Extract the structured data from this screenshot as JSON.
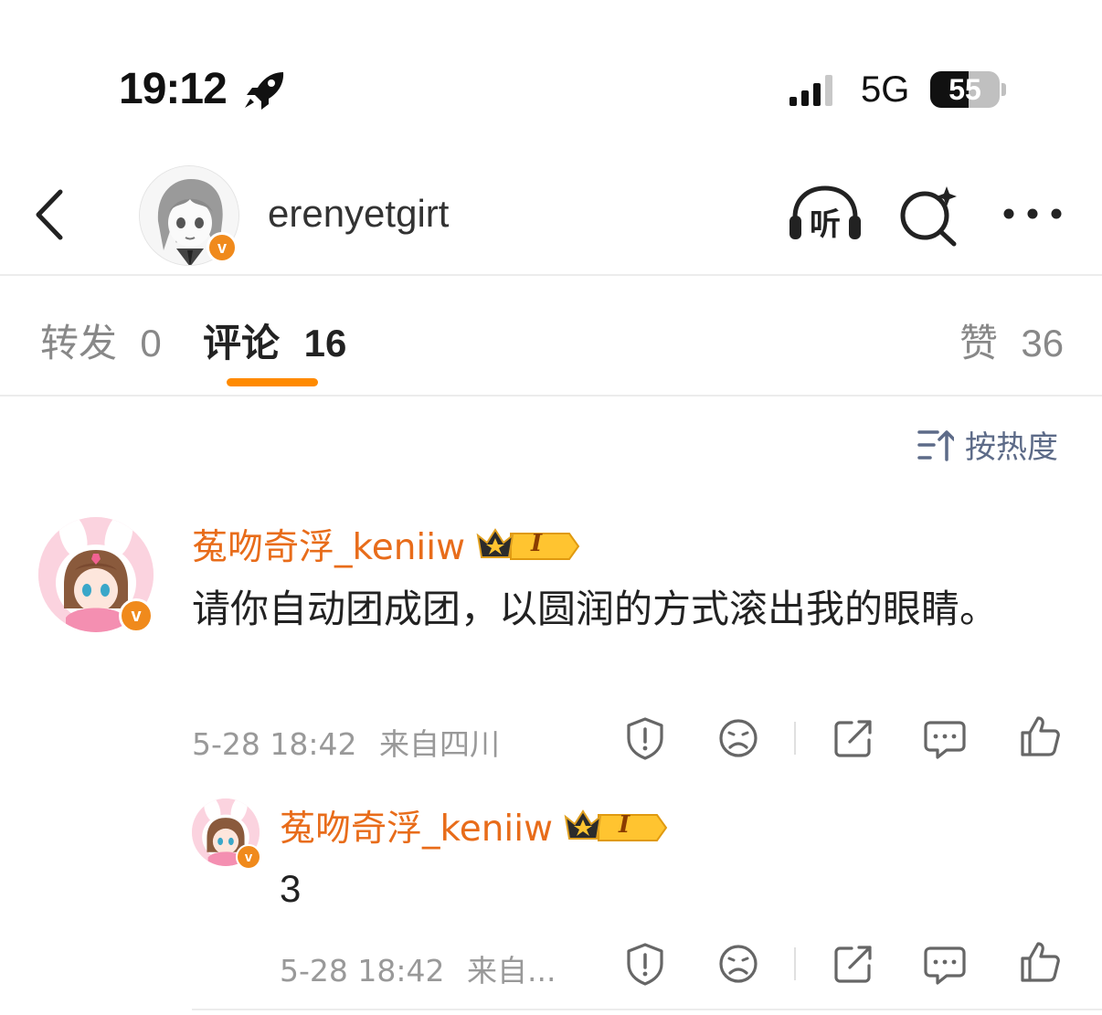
{
  "status_bar": {
    "time": "19:12",
    "network": "5G",
    "battery": "55",
    "icons": [
      "rocket-icon",
      "signal-icon",
      "battery-icon"
    ]
  },
  "header": {
    "username": "erenyetgirt",
    "verified_mark": "v",
    "listen_label": "听",
    "icons": [
      "back-icon",
      "listen-icon",
      "search-icon",
      "more-icon"
    ]
  },
  "tabs": {
    "repost": {
      "label": "转发",
      "count": "0"
    },
    "comments": {
      "label": "评论",
      "count": "16"
    },
    "likes": {
      "label": "赞",
      "count": "36"
    }
  },
  "sort": {
    "label": "按热度"
  },
  "comments": [
    {
      "user": "菟吻奇浮_keniiw",
      "level": "I",
      "text": "请你自动团成团，以圆润的方式滚出我的眼睛。",
      "time": "5-28 18:42",
      "location": "来自四川"
    }
  ],
  "reply": {
    "user": "菟吻奇浮_keniiw",
    "level": "I",
    "text": "3",
    "time": "5-28 18:42",
    "location": "来自..."
  },
  "colors": {
    "accent": "#ff8a00",
    "username": "#e86c1a",
    "verified": "#f08a1c",
    "sort": "#5d6b88",
    "meta": "#999999"
  }
}
